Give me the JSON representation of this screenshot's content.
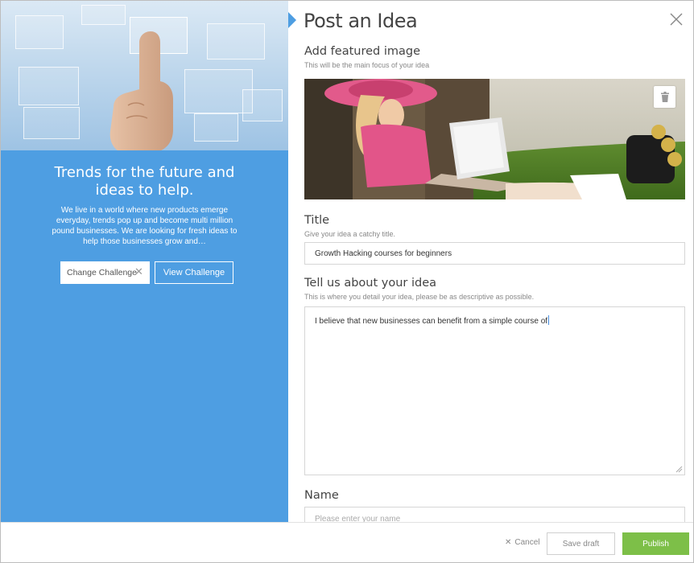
{
  "left_panel": {
    "title": "Trends for the future and ideas to help.",
    "description": "We live in a world where new products emerge everyday, trends pop up and become multi million pound businesses. We are looking for fresh ideas to help those businesses grow and…",
    "change_label": "Change Challenge",
    "view_label": "View Challenge"
  },
  "form": {
    "heading": "Post an Idea",
    "featured": {
      "label": "Add featured image",
      "help": "This will be the main focus of your idea"
    },
    "title_field": {
      "label": "Title",
      "help": "Give your idea a catchy title.",
      "value": "Growth Hacking courses for beginners"
    },
    "about_field": {
      "label": "Tell us about your idea",
      "help": "This is where you detail your idea, please be as descriptive as possible.",
      "value": "I believe that new businesses can benefit from a simple course of"
    },
    "name_field": {
      "label": "Name",
      "placeholder": "Please enter your name"
    }
  },
  "footer": {
    "cancel_label": "Cancel",
    "save_label": "Save draft",
    "publish_label": "Publish"
  },
  "colors": {
    "left_panel_bg": "#4e9ee2",
    "publish_bg": "#7dbf48"
  },
  "icons": {
    "close": "close-icon",
    "trash": "trash-icon",
    "cancel": "x-icon"
  }
}
